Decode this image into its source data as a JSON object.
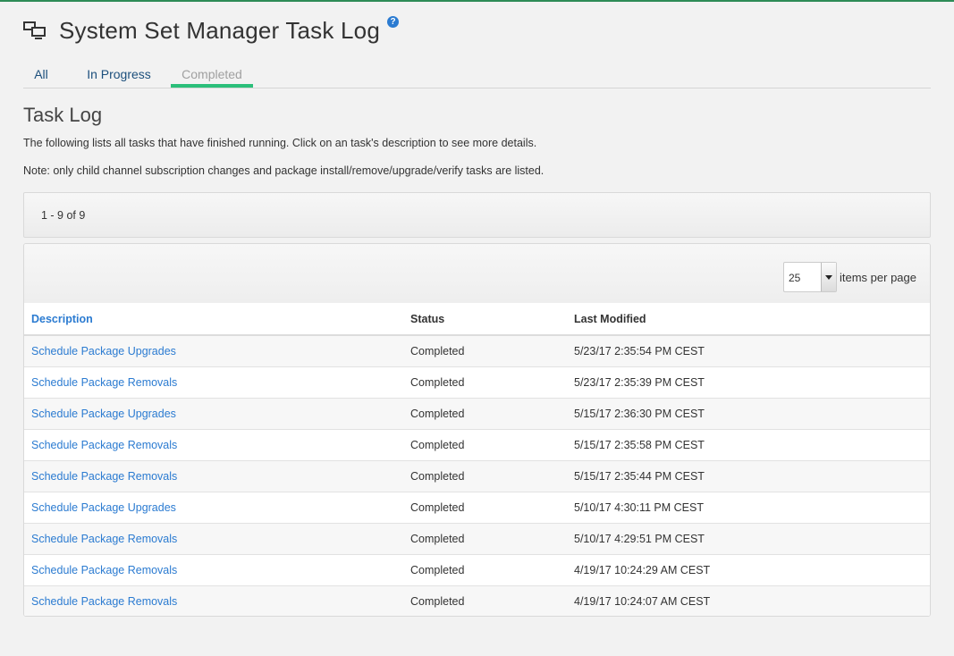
{
  "header": {
    "title": "System Set Manager Task Log",
    "icon": "systems-icon",
    "help_icon": "help-icon",
    "help_glyph": "?"
  },
  "tabs": [
    {
      "label": "All",
      "active": false
    },
    {
      "label": "In Progress",
      "active": false
    },
    {
      "label": "Completed",
      "active": true
    }
  ],
  "section": {
    "title": "Task Log",
    "description": "The following lists all tasks that have finished running. Click on an task's description to see more details.",
    "note": "Note: only child channel subscription changes and package install/remove/upgrade/verify tasks are listed."
  },
  "pagination": {
    "range_text": "1 - 9 of 9",
    "per_page_value": "25",
    "per_page_label": "items per page"
  },
  "table": {
    "columns": [
      "Description",
      "Status",
      "Last Modified"
    ],
    "rows": [
      {
        "description": "Schedule Package Upgrades",
        "status": "Completed",
        "modified": "5/23/17 2:35:54 PM CEST"
      },
      {
        "description": "Schedule Package Removals",
        "status": "Completed",
        "modified": "5/23/17 2:35:39 PM CEST"
      },
      {
        "description": "Schedule Package Upgrades",
        "status": "Completed",
        "modified": "5/15/17 2:36:30 PM CEST"
      },
      {
        "description": "Schedule Package Removals",
        "status": "Completed",
        "modified": "5/15/17 2:35:58 PM CEST"
      },
      {
        "description": "Schedule Package Removals",
        "status": "Completed",
        "modified": "5/15/17 2:35:44 PM CEST"
      },
      {
        "description": "Schedule Package Upgrades",
        "status": "Completed",
        "modified": "5/10/17 4:30:11 PM CEST"
      },
      {
        "description": "Schedule Package Removals",
        "status": "Completed",
        "modified": "5/10/17 4:29:51 PM CEST"
      },
      {
        "description": "Schedule Package Removals",
        "status": "Completed",
        "modified": "4/19/17 10:24:29 AM CEST"
      },
      {
        "description": "Schedule Package Removals",
        "status": "Completed",
        "modified": "4/19/17 10:24:07 AM CEST"
      }
    ]
  },
  "colors": {
    "accent": "#2bbf7a",
    "link": "#2b7bd1",
    "top_bar": "#2e8b57"
  }
}
